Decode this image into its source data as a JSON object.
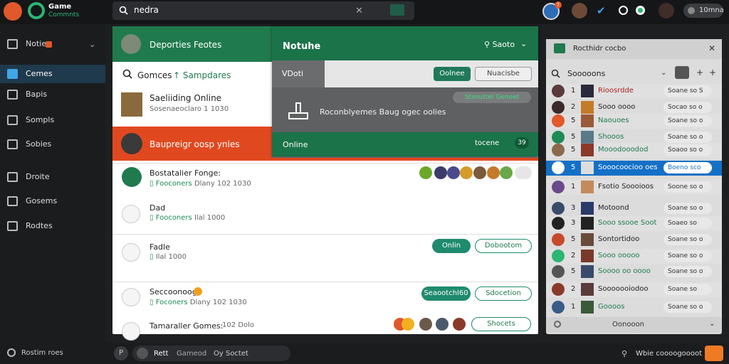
{
  "app": {
    "title_line1": "Game",
    "title_line2": "Commnts"
  },
  "search": {
    "value": "nedra"
  },
  "topbar": {
    "badge_count": "7",
    "user_label": "10mna"
  },
  "sidebar": {
    "items": [
      {
        "label": "Notie"
      },
      {
        "label": "Cemes"
      },
      {
        "label": "Bapis"
      },
      {
        "label": "Sompls"
      },
      {
        "label": "Sobies"
      },
      {
        "label": "Droite"
      },
      {
        "label": "Gosems"
      },
      {
        "label": "Rodtes"
      }
    ],
    "status": "Rostim roes"
  },
  "main": {
    "header_title": "Deporties Feotes",
    "category_label": "Gomces",
    "category_link": "Sampdares",
    "game1_title": "Saeliiding Online",
    "game1_sub": "Sosenaeoclaro 1 1030",
    "red_title": "Baupreigr oosp ynles"
  },
  "notification": {
    "title": "Notuhe",
    "sort_label": "Saoto",
    "tab_label": "VDoti",
    "btn_online": "Oolnee",
    "btn_secondary": "Nuacisbe",
    "tag": "Stsnuttel Genoet",
    "message": "Roconblyemes Baug ogec oolies",
    "footer_left": "Online",
    "footer_right": "tocene",
    "footer_badge": "39"
  },
  "feed": [
    {
      "title": "Bostatalier Fonge:",
      "sub_a": "Fooconers",
      "sub_b": "Dlany 102 1030"
    },
    {
      "title": "Dad",
      "sub_a": "Fooconers",
      "sub_b": "Ilal 1000"
    },
    {
      "title": "Fadle",
      "sub_a": "",
      "sub_b": "Ilal 1000",
      "btn1": "Onlin",
      "btn2": "Dobootom"
    },
    {
      "title": "Seccoonoog",
      "sub_a": "Foconers",
      "sub_b": "Dlany 102 1030",
      "btn1": "Seaootchl60",
      "btn2": "Sdocetion"
    },
    {
      "title": "Tamaraller Gomes:",
      "sub_a": "",
      "sub_b": "102 Dolo",
      "btn2": "Shocets"
    }
  ],
  "right_panel": {
    "title": "Rocthidr cocbo",
    "search_label": "Sooooons",
    "footer": "Oonooon",
    "rows": [
      {
        "num": "1",
        "name": "Rioosrdde",
        "pill": "Soane so",
        "mark": "S"
      },
      {
        "num": "2",
        "name": "Sooo oooo",
        "pill": "Socao so",
        "mark": "o"
      },
      {
        "num": "5",
        "name": "Naouoes",
        "pill": "Soane so",
        "mark": "o"
      },
      {
        "num": "5",
        "name": "Shooos",
        "pill": "Soane so",
        "mark": "o"
      },
      {
        "num": "5",
        "name": "Mooodooodod",
        "pill": "Soaoo so",
        "mark": "o"
      },
      {
        "num": "5",
        "name": "Sooocoocioo oes",
        "pill": "Boeno sco",
        "mark": ""
      },
      {
        "num": "1",
        "name": "Fsotio Soooioos",
        "pill": "Soone so",
        "mark": "o"
      },
      {
        "num": "3",
        "name": "Motoond",
        "pill": "Soane so",
        "mark": "o"
      },
      {
        "num": "3",
        "name": "Sooo ssooe Soot",
        "pill": "Soaeo so",
        "mark": ""
      },
      {
        "num": "5",
        "name": "Sontortidoo",
        "pill": "Soane so",
        "mark": "o"
      },
      {
        "num": "2",
        "name": "Sooo ooooo",
        "pill": "Soane so",
        "mark": "o"
      },
      {
        "num": "5",
        "name": "Soooo oo oooo",
        "pill": "Soane so",
        "mark": "o"
      },
      {
        "num": "2",
        "name": "Sooooooiodoo",
        "pill": "Soane so",
        "mark": ""
      },
      {
        "num": "1",
        "name": "Goooos",
        "pill": "Soane so",
        "mark": "o"
      }
    ]
  },
  "bottombar": {
    "p_label": "P",
    "t1": "Rett",
    "t2": "Gameod",
    "t3": "Oy Soctet",
    "help": "Wbie coooogoooot"
  },
  "colors": {
    "accent_green": "#1f7a4d",
    "accent_red": "#e0491f",
    "selected_blue": "#1470c7",
    "orange": "#ef7a24"
  }
}
